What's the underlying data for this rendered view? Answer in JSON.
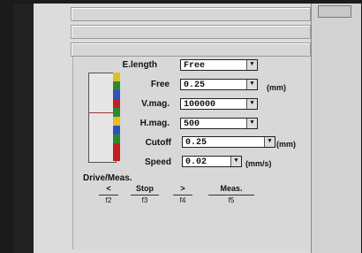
{
  "parameters": [
    {
      "label": "E.length",
      "value": "Free",
      "unit": ""
    },
    {
      "label": "Free",
      "value": "0.25",
      "unit": "(mm)"
    },
    {
      "label": "V.mag.",
      "value": "100000",
      "unit": ""
    },
    {
      "label": "H.mag.",
      "value": "500",
      "unit": ""
    },
    {
      "label": "Cutoff",
      "value": "0.25",
      "unit": "(mm)"
    },
    {
      "label": "Speed",
      "value": "0.02",
      "unit": "(mm/s)"
    }
  ],
  "drive": {
    "title": "Drive/Meas.",
    "buttons": [
      {
        "label": "<",
        "key": "f2"
      },
      {
        "label": "Stop",
        "key": "f3"
      },
      {
        "label": ">",
        "key": "f4"
      },
      {
        "label": "Meas.",
        "key": "f5"
      }
    ]
  },
  "indicator_colors": [
    "#e0c020",
    "#2a8a2a",
    "#3050c0",
    "#c02020",
    "#2a8a2a",
    "#e0c020",
    "#3050c0",
    "#2a8a2a",
    "#c02020",
    "#c02020"
  ],
  "icons": {
    "dropdown": "chevron-down-icon"
  }
}
